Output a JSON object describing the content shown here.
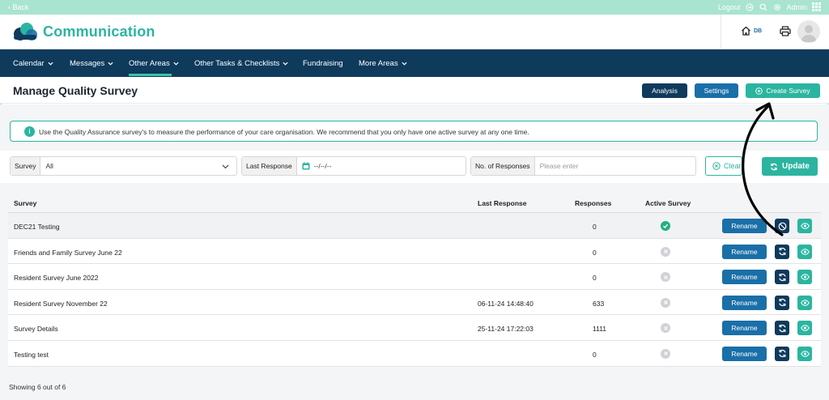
{
  "topbar": {
    "back": "‹ Back",
    "logout": "Logout",
    "user": "Admin"
  },
  "brand": {
    "name": "Communication",
    "home_badge": "DB"
  },
  "nav": [
    {
      "label": "Calendar"
    },
    {
      "label": "Messages"
    },
    {
      "label": "Other Areas"
    },
    {
      "label": "Other Tasks & Checklists"
    },
    {
      "label": "Fundraising"
    },
    {
      "label": "More Areas"
    }
  ],
  "header": {
    "title": "Manage Quality Survey",
    "analysis": "Analysis",
    "settings": "Settings",
    "create": "Create Survey"
  },
  "info": {
    "icon": "i",
    "text": "Use the Quality Assurance survey's to measure the performance of your care organisation. We recommend that you only have one active survey at any one time."
  },
  "filters": {
    "survey_label": "Survey",
    "survey_value": "All",
    "last_label": "Last Response",
    "last_value": "--/--/--",
    "resp_label": "No. of Responses",
    "resp_placeholder": "Please enter",
    "clear": "Clear",
    "update": "Update"
  },
  "table": {
    "headers": {
      "survey": "Survey",
      "last": "Last Response",
      "responses": "Responses",
      "active": "Active Survey"
    },
    "rename_label": "Rename",
    "rows": [
      {
        "name": "DEC21 Testing",
        "last": "",
        "responses": "0",
        "active": true
      },
      {
        "name": "Friends and Family Survey June 22",
        "last": "",
        "responses": "0",
        "active": false
      },
      {
        "name": "Resident Survey June 2022",
        "last": "",
        "responses": "0",
        "active": false
      },
      {
        "name": "Resident Survey November 22",
        "last": "06-11-24 14:48:40",
        "responses": "633",
        "active": false
      },
      {
        "name": "Survey Details",
        "last": "25-11-24 17:22:03",
        "responses": "1111",
        "active": false
      },
      {
        "name": "Testing test",
        "last": "",
        "responses": "0",
        "active": false
      }
    ]
  },
  "footer": {
    "showing": "Showing 6 out of 6"
  },
  "colors": {
    "teal": "#2bb5a0",
    "navy": "#0e3a5c",
    "blue": "#1a6fa8",
    "mint": "#a8e4d0"
  }
}
